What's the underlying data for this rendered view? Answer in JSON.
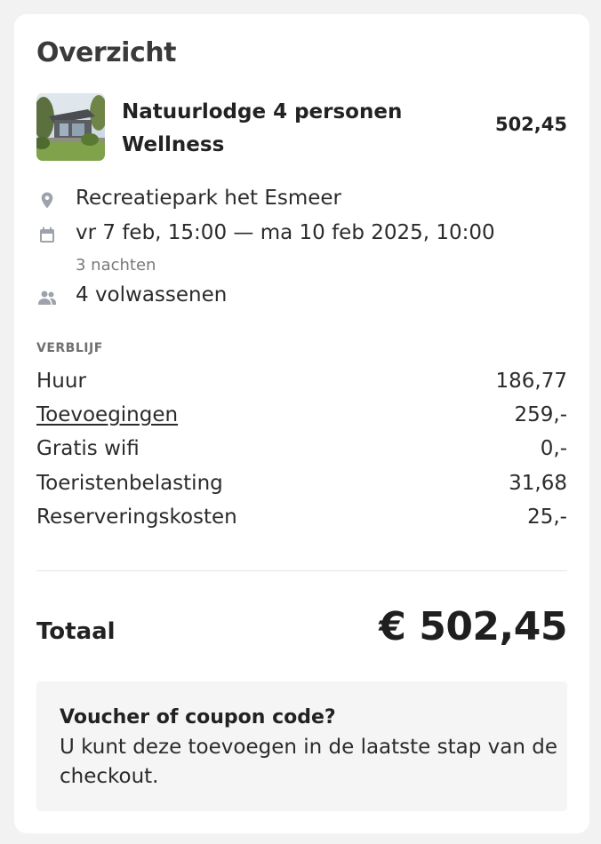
{
  "overview": {
    "title": "Overzicht",
    "accommodation": {
      "name": "Natuurlodge 4 personen Wellness",
      "price": "502,45"
    },
    "location": "Recreatiepark het Esmeer",
    "dates": "vr 7 feb, 15:00 — ma 10 feb 2025, 10:00",
    "nights": "3 nachten",
    "guests": "4 volwassenen",
    "icons": {
      "location": "location-pin-icon",
      "dates": "calendar-icon",
      "guests": "people-icon"
    }
  },
  "stay": {
    "label": "VERBLIJF",
    "lines": [
      {
        "label": "Huur",
        "value": "186,77"
      },
      {
        "label": "Toevoegingen",
        "value": "259,-"
      },
      {
        "label": "Gratis wifi",
        "value": "0,-"
      },
      {
        "label": "Toeristenbelasting",
        "value": "31,68"
      },
      {
        "label": "Reserveringskosten",
        "value": "25,-"
      }
    ]
  },
  "total": {
    "label": "Totaal",
    "value": "€ 502,45"
  },
  "voucher": {
    "title": "Voucher of coupon code?",
    "text": "U kunt deze toevoegen in de laatste stap van de checkout."
  },
  "colors": {
    "icon": "#9ea3ab",
    "card": "#ffffff",
    "voucher_bg": "#f5f5f5"
  }
}
